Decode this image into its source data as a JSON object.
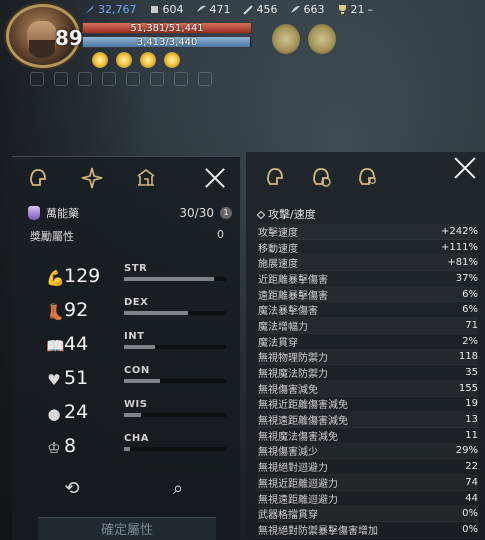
{
  "player": {
    "level": "89"
  },
  "currencies": [
    {
      "icon": "feather-icon",
      "value": "32,767"
    },
    {
      "icon": "resource-icon",
      "value": "604"
    },
    {
      "icon": "wing-icon",
      "value": "471"
    },
    {
      "icon": "sword-icon",
      "value": "456"
    },
    {
      "icon": "blade-icon",
      "value": "663"
    },
    {
      "icon": "trophy-icon",
      "value": "21"
    }
  ],
  "hp": {
    "text": "51,381/51,441",
    "fraction": 0.999
  },
  "mp": {
    "text": "3,413/3,440",
    "fraction": 0.992
  },
  "left_panel": {
    "potion": {
      "name": "萬能藥",
      "count": "30/30",
      "badge": "1"
    },
    "bonus": {
      "label": "獎勵屬性",
      "value": "0"
    },
    "stats": [
      {
        "name": "STR",
        "value": "129",
        "icon": "arm-icon",
        "fill": 0.88
      },
      {
        "name": "DEX",
        "value": "92",
        "icon": "boot-icon",
        "fill": 0.63
      },
      {
        "name": "INT",
        "value": "44",
        "icon": "book-icon",
        "fill": 0.3
      },
      {
        "name": "CON",
        "value": "51",
        "icon": "heart-icon",
        "fill": 0.35
      },
      {
        "name": "WIS",
        "value": "24",
        "icon": "head-icon",
        "fill": 0.17
      },
      {
        "name": "CHA",
        "value": "8",
        "icon": "crown-icon",
        "fill": 0.06
      }
    ],
    "confirm_label": "確定屬性"
  },
  "right_panel": {
    "section_title": "攻擊/速度",
    "rows": [
      {
        "k": "攻擊速度",
        "v": "+242%"
      },
      {
        "k": "移動速度",
        "v": "+111%"
      },
      {
        "k": "施展速度",
        "v": "+81%"
      },
      {
        "k": "近距離暴擊傷害",
        "v": "37%"
      },
      {
        "k": "遠距離暴擊傷害",
        "v": "6%"
      },
      {
        "k": "魔法暴擊傷害",
        "v": "6%"
      },
      {
        "k": "魔法增幅力",
        "v": "71"
      },
      {
        "k": "魔法貫穿",
        "v": "2%"
      },
      {
        "k": "無視物理防禦力",
        "v": "118"
      },
      {
        "k": "無視魔法防禦力",
        "v": "35"
      },
      {
        "k": "無視傷害減免",
        "v": "155"
      },
      {
        "k": "無視近距離傷害減免",
        "v": "19"
      },
      {
        "k": "無視遠距離傷害減免",
        "v": "13"
      },
      {
        "k": "無視魔法傷害減免",
        "v": "11"
      },
      {
        "k": "無視傷害減少",
        "v": "29%"
      },
      {
        "k": "無視絕對迴避力",
        "v": "22"
      },
      {
        "k": "無視近距離迴避力",
        "v": "74"
      },
      {
        "k": "無視遠距離迴避力",
        "v": "44"
      },
      {
        "k": "武器格擋貫穿",
        "v": "0%"
      },
      {
        "k": "無視絕對防禦暴擊傷害增加",
        "v": "0%"
      }
    ]
  }
}
